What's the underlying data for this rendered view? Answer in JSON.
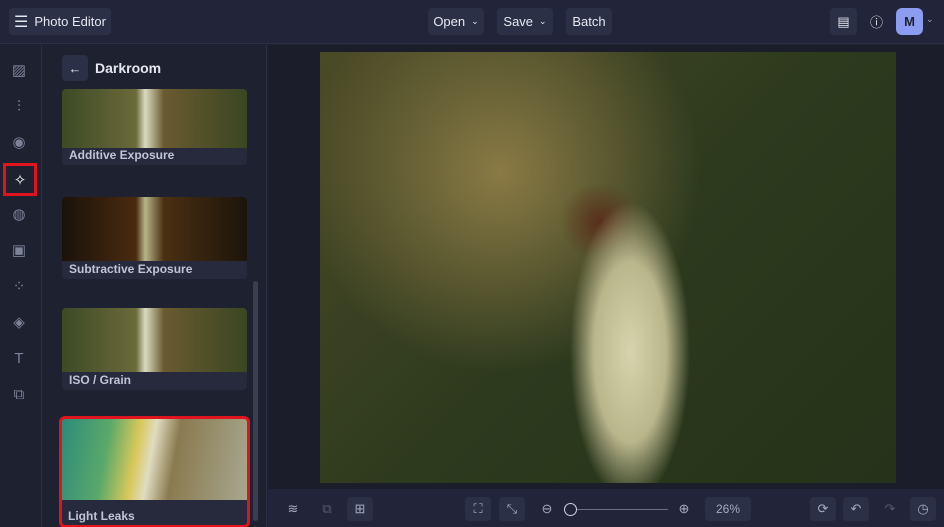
{
  "header": {
    "title": "Photo Editor",
    "open": "Open",
    "save": "Save",
    "batch": "Batch",
    "avatar": "M"
  },
  "panel": {
    "title": "Darkroom",
    "effects": [
      {
        "label": "Additive Exposure"
      },
      {
        "label": "Subtractive Exposure"
      },
      {
        "label": "ISO / Grain"
      },
      {
        "label": "Light Leaks"
      }
    ]
  },
  "zoom": {
    "value": "26%",
    "level": 0.0
  },
  "colors": {
    "accent": "#8c9cf0",
    "highlight": "#e0141e"
  }
}
